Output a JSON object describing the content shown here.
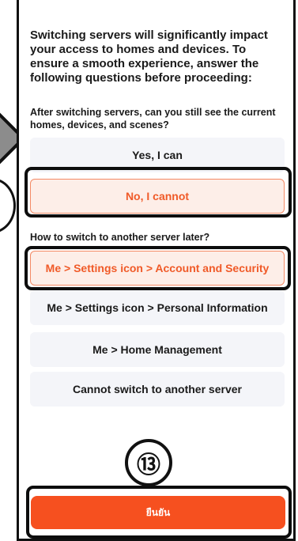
{
  "intro_text": "Switching servers will significantly impact your access to homes and devices. To ensure a smooth experience, answer the following questions before proceeding:",
  "question1": {
    "text": "After switching servers, can you still see the current homes, devices, and scenes?",
    "options": [
      {
        "label": "Yes, I can",
        "selected": false
      },
      {
        "label": "No, I cannot",
        "selected": true
      }
    ]
  },
  "question2": {
    "text": "How to switch to another server later?",
    "options": [
      {
        "label": "Me > Settings icon > Account and Security",
        "selected": true
      },
      {
        "label": "Me > Settings icon > Personal Information",
        "selected": false
      },
      {
        "label": "Me > Home Management",
        "selected": false
      },
      {
        "label": "Cannot switch to another server",
        "selected": false
      }
    ]
  },
  "step_badge": "⑬",
  "confirm_label": "ยืนยัน",
  "colors": {
    "accent": "#f6501f",
    "selected_bg": "#fdeee8",
    "selected_text": "#f05a28",
    "option_bg": "#f4f5f9"
  }
}
